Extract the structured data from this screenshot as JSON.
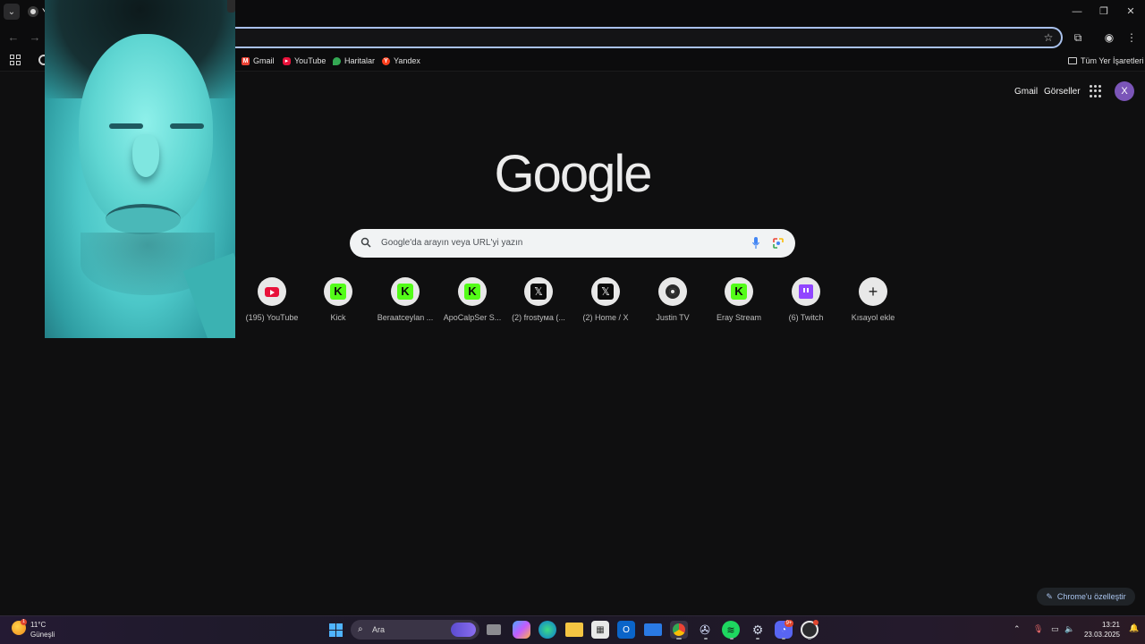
{
  "browser": {
    "tab_title_initial": "Y",
    "window_controls": {
      "minimize": "—",
      "restore": "❐",
      "close": "✕"
    },
    "bookmarks": [
      {
        "label": "Gmail",
        "color": "#ea4335"
      },
      {
        "label": "YouTube",
        "color": "#e8113a"
      },
      {
        "label": "Haritalar",
        "color": "#34a853"
      },
      {
        "label": "Yandex",
        "color": "#fc3f1d"
      }
    ],
    "all_bookmarks": "Tüm Yer İşaretleri"
  },
  "google": {
    "top_links": {
      "gmail": "Gmail",
      "images": "Görseller"
    },
    "account_initial": "X",
    "logo": "Google",
    "search_placeholder": "Google'da arayın veya URL'yi yazın",
    "shortcuts": [
      {
        "label": "(195) YouTube",
        "icon": "youtube-icon"
      },
      {
        "label": "Kick",
        "icon": "kick-icon"
      },
      {
        "label": "Beraatceylan ...",
        "icon": "kick-icon"
      },
      {
        "label": "ApoCalpSer S...",
        "icon": "kick-icon"
      },
      {
        "label": "(2) frostyма (...",
        "icon": "x-icon"
      },
      {
        "label": "(2) Home / X",
        "icon": "x-icon"
      },
      {
        "label": "Justin TV",
        "icon": "justintv-icon"
      },
      {
        "label": "Eray Stream",
        "icon": "kick-icon"
      },
      {
        "label": "(6) Twitch",
        "icon": "twitch-icon"
      },
      {
        "label": "Kısayol ekle",
        "icon": "plus-icon"
      }
    ],
    "customize": "Chrome'u özelleştir"
  },
  "taskbar": {
    "weather_temp": "11°C",
    "weather_desc": "Güneşli",
    "weather_badge": "1",
    "search_placeholder": "Ara",
    "discord_badge": "9+",
    "time": "13:21",
    "date": "23.03.2025"
  }
}
